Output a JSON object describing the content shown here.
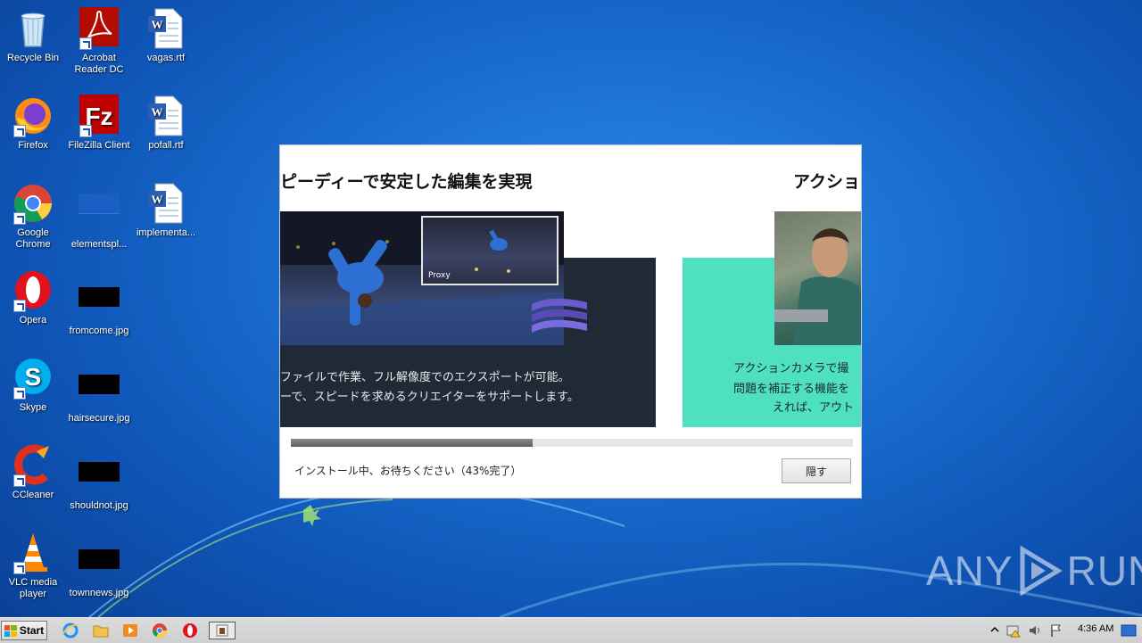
{
  "desktop": {
    "icons": [
      {
        "label": "Recycle Bin"
      },
      {
        "label": "Acrobat Reader DC"
      },
      {
        "label": "vagas.rtf"
      },
      {
        "label": "Firefox"
      },
      {
        "label": "FileZilla Client"
      },
      {
        "label": "pofall.rtf"
      },
      {
        "label": "Google Chrome"
      },
      {
        "label": "elementspl..."
      },
      {
        "label": "implementa..."
      },
      {
        "label": "Opera"
      },
      {
        "label": "fromcome.jpg"
      },
      {
        "label": "Skype"
      },
      {
        "label": "hairsecure.jpg"
      },
      {
        "label": "CCleaner"
      },
      {
        "label": "shouldnot.jpg"
      },
      {
        "label": "VLC media player"
      },
      {
        "label": "townnews.jpg"
      }
    ]
  },
  "installer": {
    "slide1_title": "ピーディーで安定した編集を実現",
    "slide2_title": "アクショ",
    "proxy_label": "Proxy",
    "slide1_desc_line1": "ファイルで作業、フル解像度でのエクスポートが可能。",
    "slide1_desc_line2": "ーで、スピードを求めるクリエイターをサポートします。",
    "slide2_desc_line1": "アクションカメラで撮",
    "slide2_desc_line2": "問題を補正する機能を",
    "slide2_desc_line3": "えれば、アウト",
    "progress_percent": 43,
    "status_text": "インストール中、お待ちください（43%完了）",
    "hide_button_label": "隠す"
  },
  "watermark": {
    "left": "ANY",
    "right": "RUN"
  },
  "taskbar": {
    "start_label": "Start",
    "clock": "4:36 AM"
  },
  "colors": {
    "panel_dark": "#1f2a36",
    "panel_teal": "#4fe0c0"
  }
}
